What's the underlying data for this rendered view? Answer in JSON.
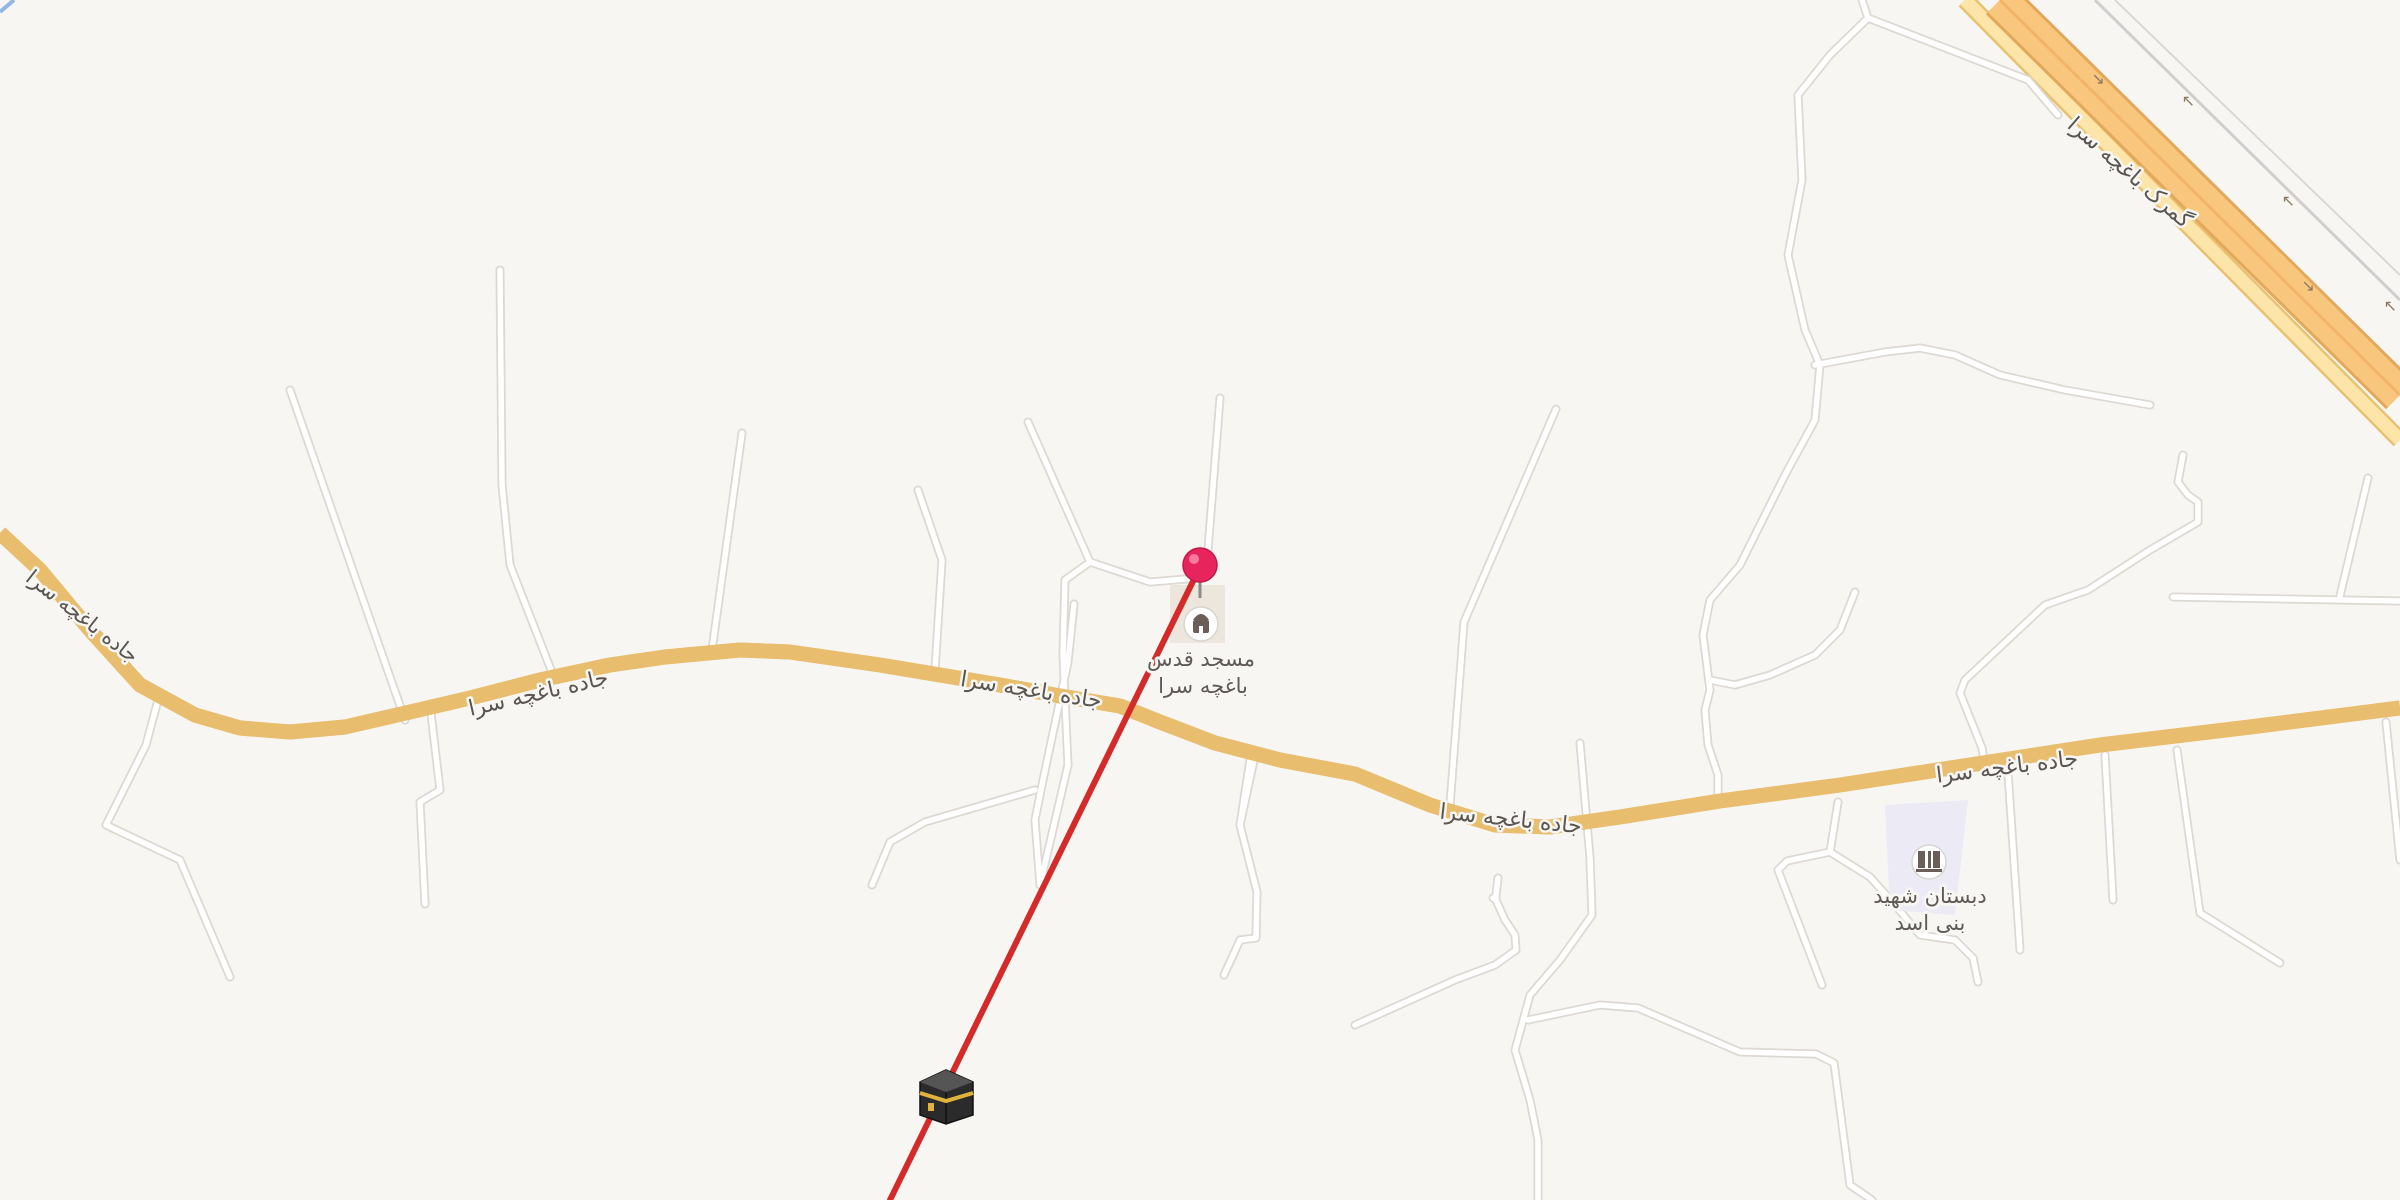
{
  "map": {
    "background_color": "#f8f6f3",
    "route_color": "#d42a2a",
    "main_road_fill": "#fbe0a2",
    "main_road_casing": "#e9bd6e",
    "highway_fill": "#f9c67e",
    "minor_road_fill": "#ffffff",
    "minor_road_casing": "#dcd8d2"
  },
  "labels": {
    "road_west_end": "جاده باغچه سرا",
    "road_west": "جاده باغچه سرا",
    "road_center": "جاده باغچه سرا",
    "road_east": "جاده باغچه سرا",
    "road_east_far": "جاده باغچه سرا",
    "highway": "گمرک باغچه سرا",
    "mosque_line1": "مسجد قدس",
    "mosque_line2": "باغچه سرا",
    "school_line1": "دبستان شهید",
    "school_line2": "بنی اسد"
  },
  "icons": {
    "location_pin": "map-pin-icon",
    "mosque": "mosque-icon",
    "school": "school-icon",
    "kaaba": "kaaba-qibla-icon"
  }
}
